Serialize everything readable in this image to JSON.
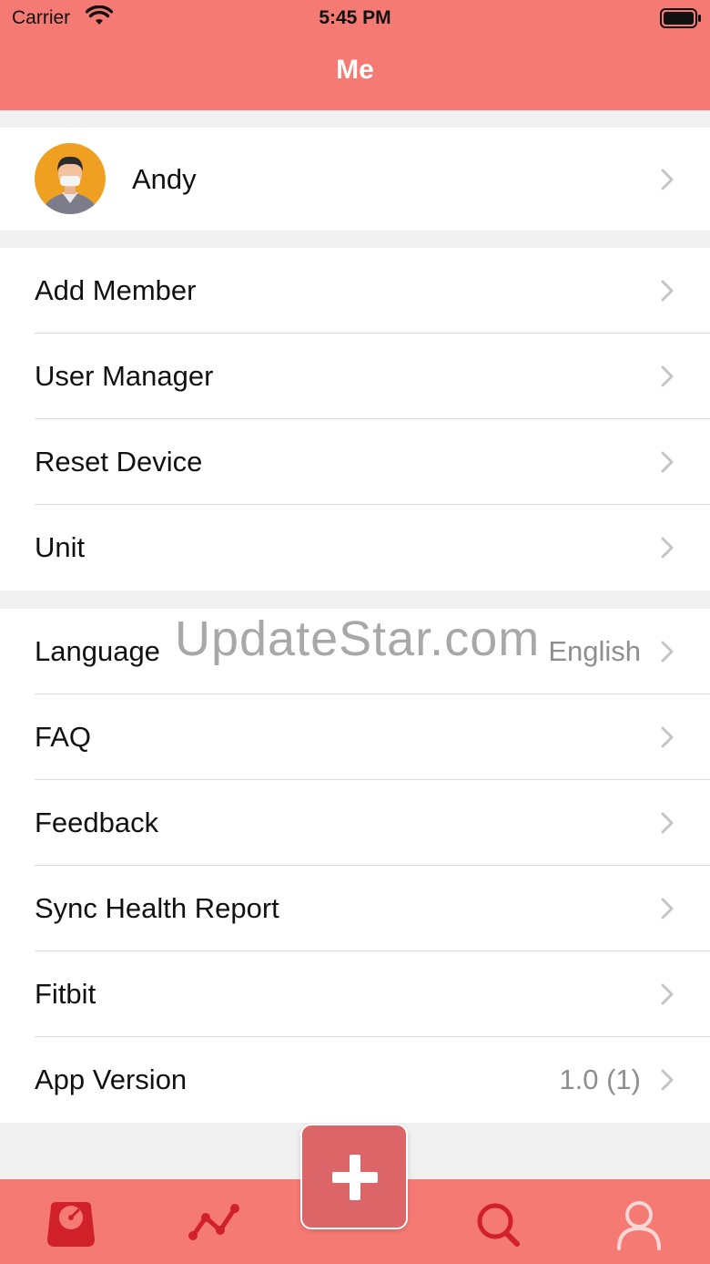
{
  "status_bar": {
    "carrier": "Carrier",
    "time": "5:45 PM"
  },
  "nav": {
    "title": "Me"
  },
  "profile": {
    "name": "Andy",
    "avatar_icon": "user-avatar-icon"
  },
  "section1": {
    "items": [
      {
        "label": "Add Member"
      },
      {
        "label": "User Manager"
      },
      {
        "label": "Reset Device"
      },
      {
        "label": "Unit"
      }
    ]
  },
  "section2": {
    "items": [
      {
        "label": "Language",
        "value": "English"
      },
      {
        "label": "FAQ"
      },
      {
        "label": "Feedback"
      },
      {
        "label": "Sync Health Report"
      },
      {
        "label": "Fitbit"
      },
      {
        "label": "App Version",
        "value": "1.0 (1)"
      }
    ]
  },
  "watermark": "UpdateStar.com",
  "tabbar": {
    "tabs": [
      {
        "icon": "scale-icon"
      },
      {
        "icon": "trend-chart-icon"
      },
      {
        "icon": "add-icon"
      },
      {
        "icon": "search-icon"
      },
      {
        "icon": "profile-icon"
      }
    ]
  },
  "colors": {
    "accent": "#f67a74",
    "fab": "#dc6567",
    "tab_icon_active": "#d0202a",
    "tab_icon_inactive": "#fbd6d4"
  }
}
